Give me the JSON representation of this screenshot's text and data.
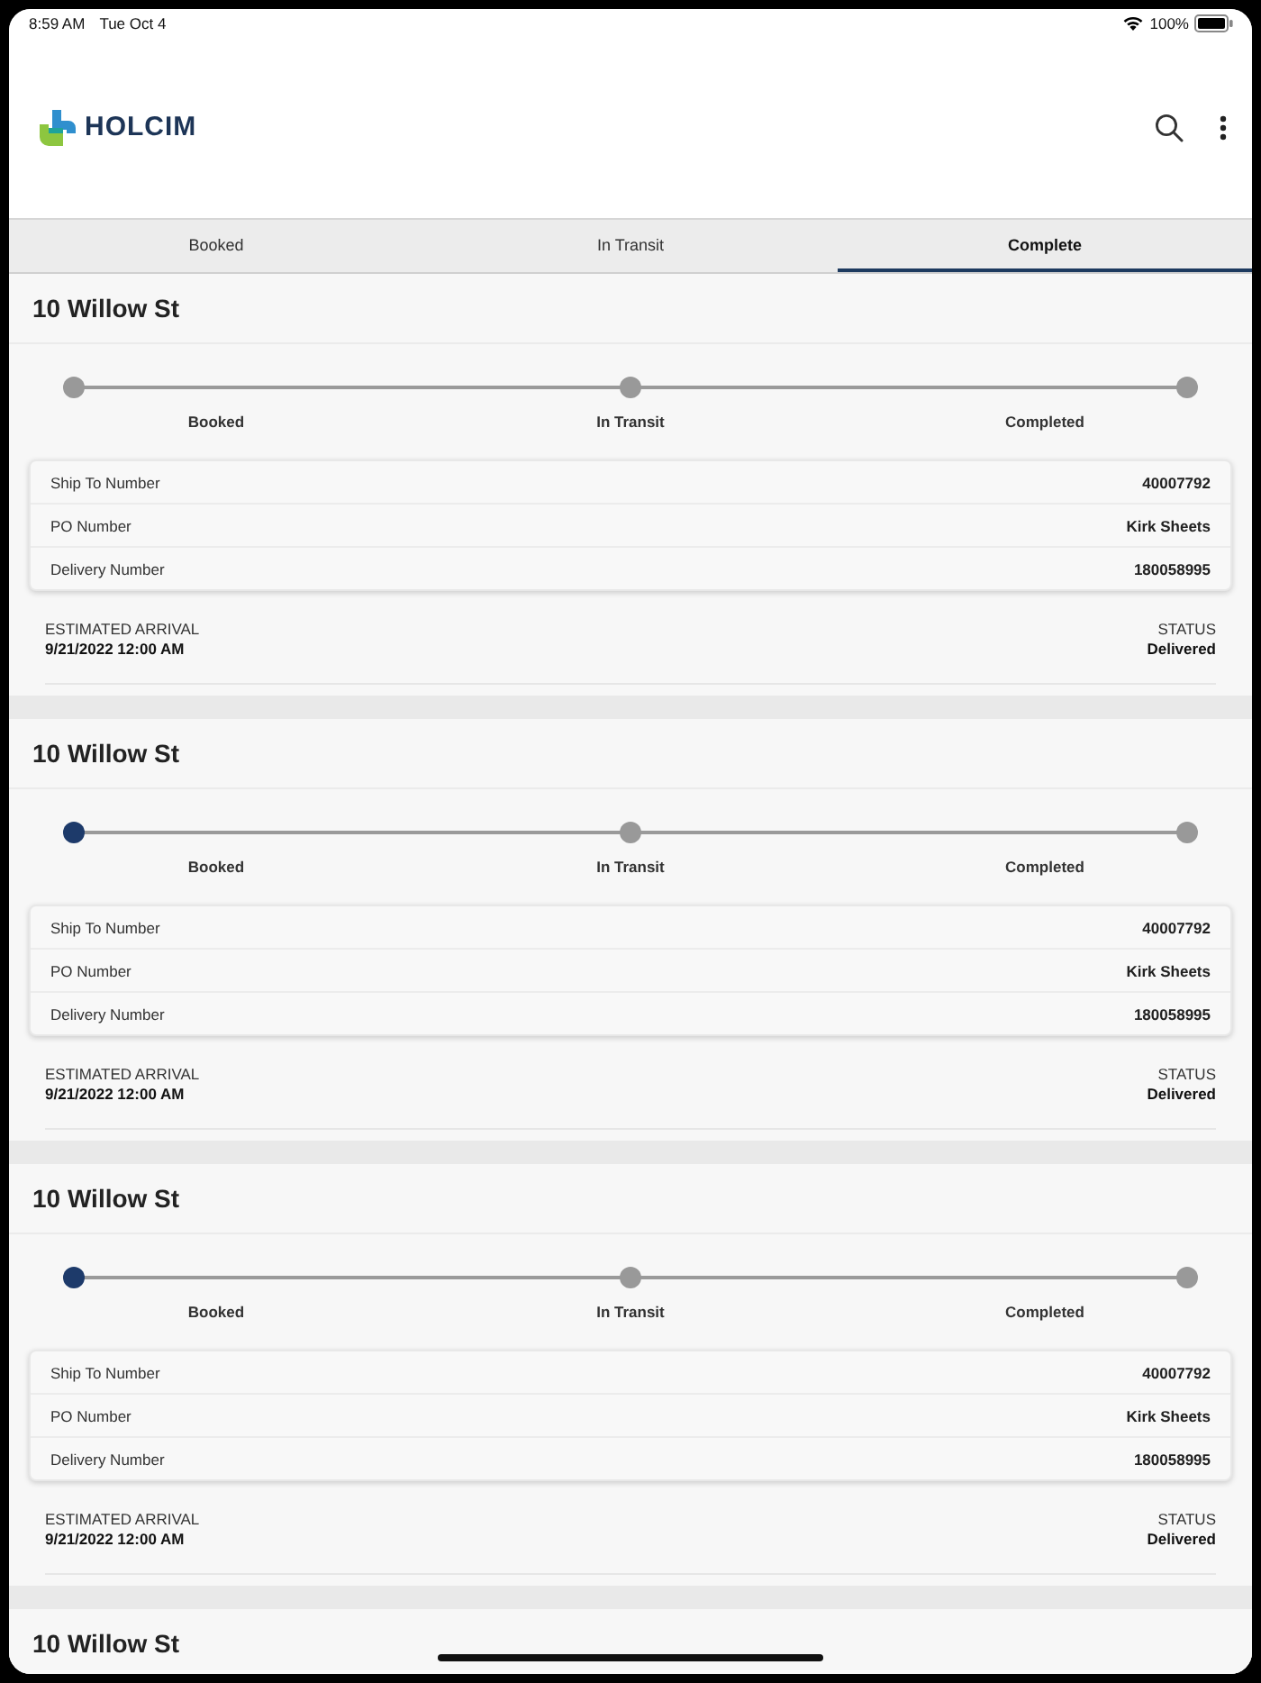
{
  "status_bar": {
    "time": "8:59 AM",
    "date": "Tue Oct 4",
    "battery": "100%"
  },
  "header": {
    "brand": "HOLCIM"
  },
  "tabs": [
    {
      "label": "Booked",
      "selected": false
    },
    {
      "label": "In Transit",
      "selected": false
    },
    {
      "label": "Complete",
      "selected": true
    }
  ],
  "cards": [
    {
      "title": "10 Willow St",
      "steps": [
        {
          "label": "Booked",
          "reached": false
        },
        {
          "label": "In Transit",
          "reached": false
        },
        {
          "label": "Completed",
          "reached": false
        }
      ],
      "details": [
        {
          "label": "Ship To Number",
          "value": "40007792"
        },
        {
          "label": "PO Number",
          "value": "Kirk Sheets"
        },
        {
          "label": "Delivery Number",
          "value": "180058995"
        }
      ],
      "arrival": {
        "label": "ESTIMATED ARRIVAL",
        "value": "9/21/2022 12:00 AM"
      },
      "status": {
        "label": "STATUS",
        "value": "Delivered"
      }
    },
    {
      "title": "10 Willow St",
      "steps": [
        {
          "label": "Booked",
          "reached": true
        },
        {
          "label": "In Transit",
          "reached": false
        },
        {
          "label": "Completed",
          "reached": false
        }
      ],
      "details": [
        {
          "label": "Ship To Number",
          "value": "40007792"
        },
        {
          "label": "PO Number",
          "value": "Kirk Sheets"
        },
        {
          "label": "Delivery Number",
          "value": "180058995"
        }
      ],
      "arrival": {
        "label": "ESTIMATED ARRIVAL",
        "value": "9/21/2022 12:00 AM"
      },
      "status": {
        "label": "STATUS",
        "value": "Delivered"
      }
    },
    {
      "title": "10 Willow St",
      "steps": [
        {
          "label": "Booked",
          "reached": true
        },
        {
          "label": "In Transit",
          "reached": false
        },
        {
          "label": "Completed",
          "reached": false
        }
      ],
      "details": [
        {
          "label": "Ship To Number",
          "value": "40007792"
        },
        {
          "label": "PO Number",
          "value": "Kirk Sheets"
        },
        {
          "label": "Delivery Number",
          "value": "180058995"
        }
      ],
      "arrival": {
        "label": "ESTIMATED ARRIVAL",
        "value": "9/21/2022 12:00 AM"
      },
      "status": {
        "label": "STATUS",
        "value": "Delivered"
      }
    },
    {
      "title": "10 Willow St"
    }
  ]
}
